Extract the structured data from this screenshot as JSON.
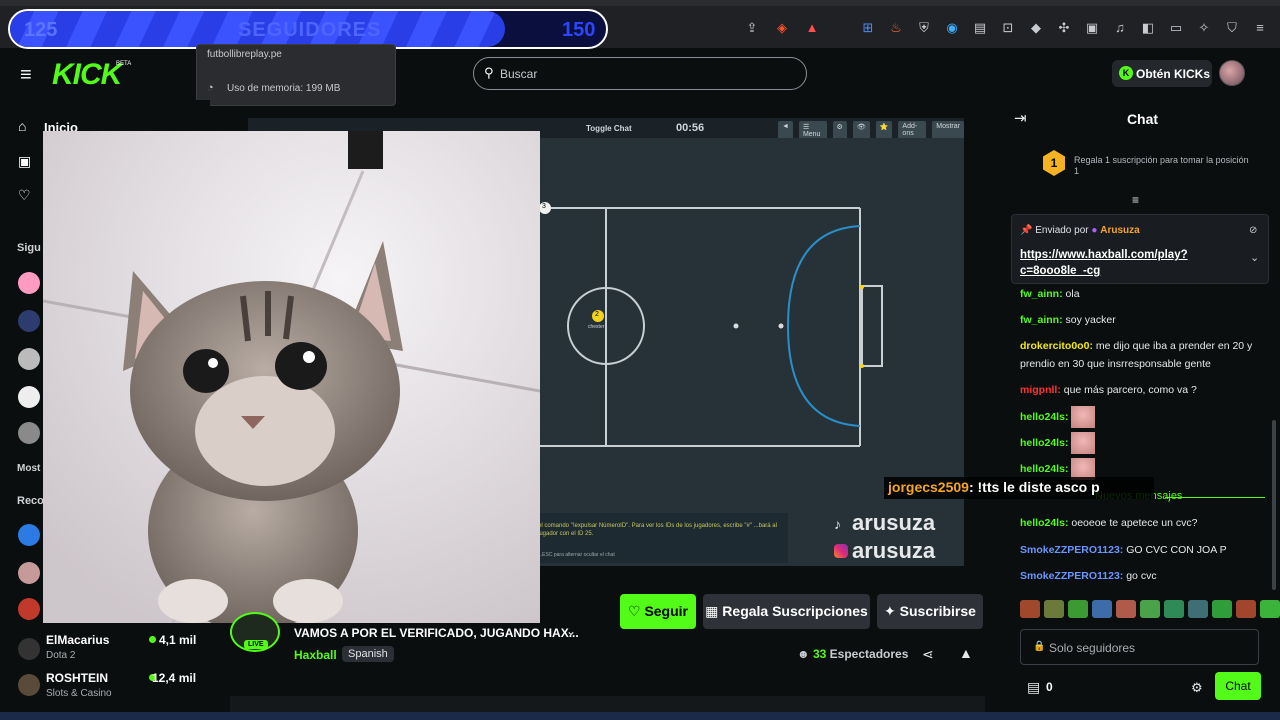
{
  "goal": {
    "current": "125",
    "label": "SEGUIDORES",
    "target": "150"
  },
  "browser": {
    "tooltip_host": "futbollibreplay.pe",
    "tooltip_memory": "Uso de memoria: 199 MB"
  },
  "header": {
    "logo": "KICK",
    "logo_badge": "BETA",
    "search_placeholder": "Buscar",
    "kicks_button": "Obtén KICKs"
  },
  "sidebar": {
    "home_label": "Inicio",
    "following_header": "Sigu",
    "most_label": "Most",
    "recommended_header": "Reco",
    "channels": [
      {
        "name": "ElMacarius",
        "category": "Dota 2",
        "viewers": "4,1 mil"
      },
      {
        "name": "ROSHTEIN",
        "category": "Slots & Casino",
        "viewers": "12,4 mil"
      }
    ]
  },
  "video": {
    "toggle_chat": "Toggle Chat",
    "time": "00:56",
    "menu_buttons": [
      "◄",
      "☰ Menu",
      "⚙",
      "👁",
      "⭐",
      "Add-ons",
      "Mostrar"
    ],
    "hint": "el comando \"!expulsar NúmeroID\". Para ver los IDs de los jugadores, escribe \"#\" ...bará al jugador con el ID 25.",
    "esc_hint": "...ESC para alternar ocultar el chat",
    "watermark_tiktok": "arusuza",
    "watermark_instagram": "arusuza",
    "player1_number": "3",
    "player2_number": "2",
    "player2_name": "chester"
  },
  "stream": {
    "title": "VAMOS A POR EL VERIFICADO, JUGANDO HAX...",
    "category": "Haxball",
    "language": "Spanish",
    "live_badge": "LIVE",
    "follow_button": "Seguir",
    "gift_button": "Regala Suscripciones",
    "subscribe_button": "Suscribirse",
    "viewers_count": "33",
    "viewers_label": "Espectadores"
  },
  "chat": {
    "title": "Chat",
    "gift_rank": "1",
    "gift_text": "Regala 1 suscripción para tomar la posición 1",
    "pinned_label": "Enviado por",
    "pinned_user": "Arusuza",
    "pinned_link": "https://www.haxball.com/play?c=8ooo8le_-cg",
    "messages": [
      {
        "user": "fw_ainn:",
        "text": "ola"
      },
      {
        "user": "fw_ainn:",
        "text": "soy yacker"
      },
      {
        "user": "drokercito0o0:",
        "text": "me dijo que iba a prender en 20 y prendio en 30 que insrresponsable gente"
      },
      {
        "user": "migpnll:",
        "text": "que más parcero, como va ?"
      },
      {
        "user": "hello24ls:",
        "text": ""
      },
      {
        "user": "hello24ls:",
        "text": ""
      },
      {
        "user": "hello24ls:",
        "text": ""
      },
      {
        "user": "hello24ls:",
        "text": "oeoeoe te apetece un cvc?"
      },
      {
        "user": "SmokeZZPERO1123:",
        "text": "GO CVC CON JOA P"
      },
      {
        "user": "SmokeZZPERO1123:",
        "text": "go cvc"
      }
    ],
    "new_messages": "Nuevos mensajes",
    "overlay_user": "jorgecs2509",
    "overlay_text": ": !tts le diste asco p",
    "input_placeholder": "Solo seguidores",
    "kick_count": "0",
    "send_button": "Chat"
  },
  "colors": {
    "accent": "#53fc18",
    "background": "#0b0e0f",
    "goal_bar": "#3b52ff"
  }
}
